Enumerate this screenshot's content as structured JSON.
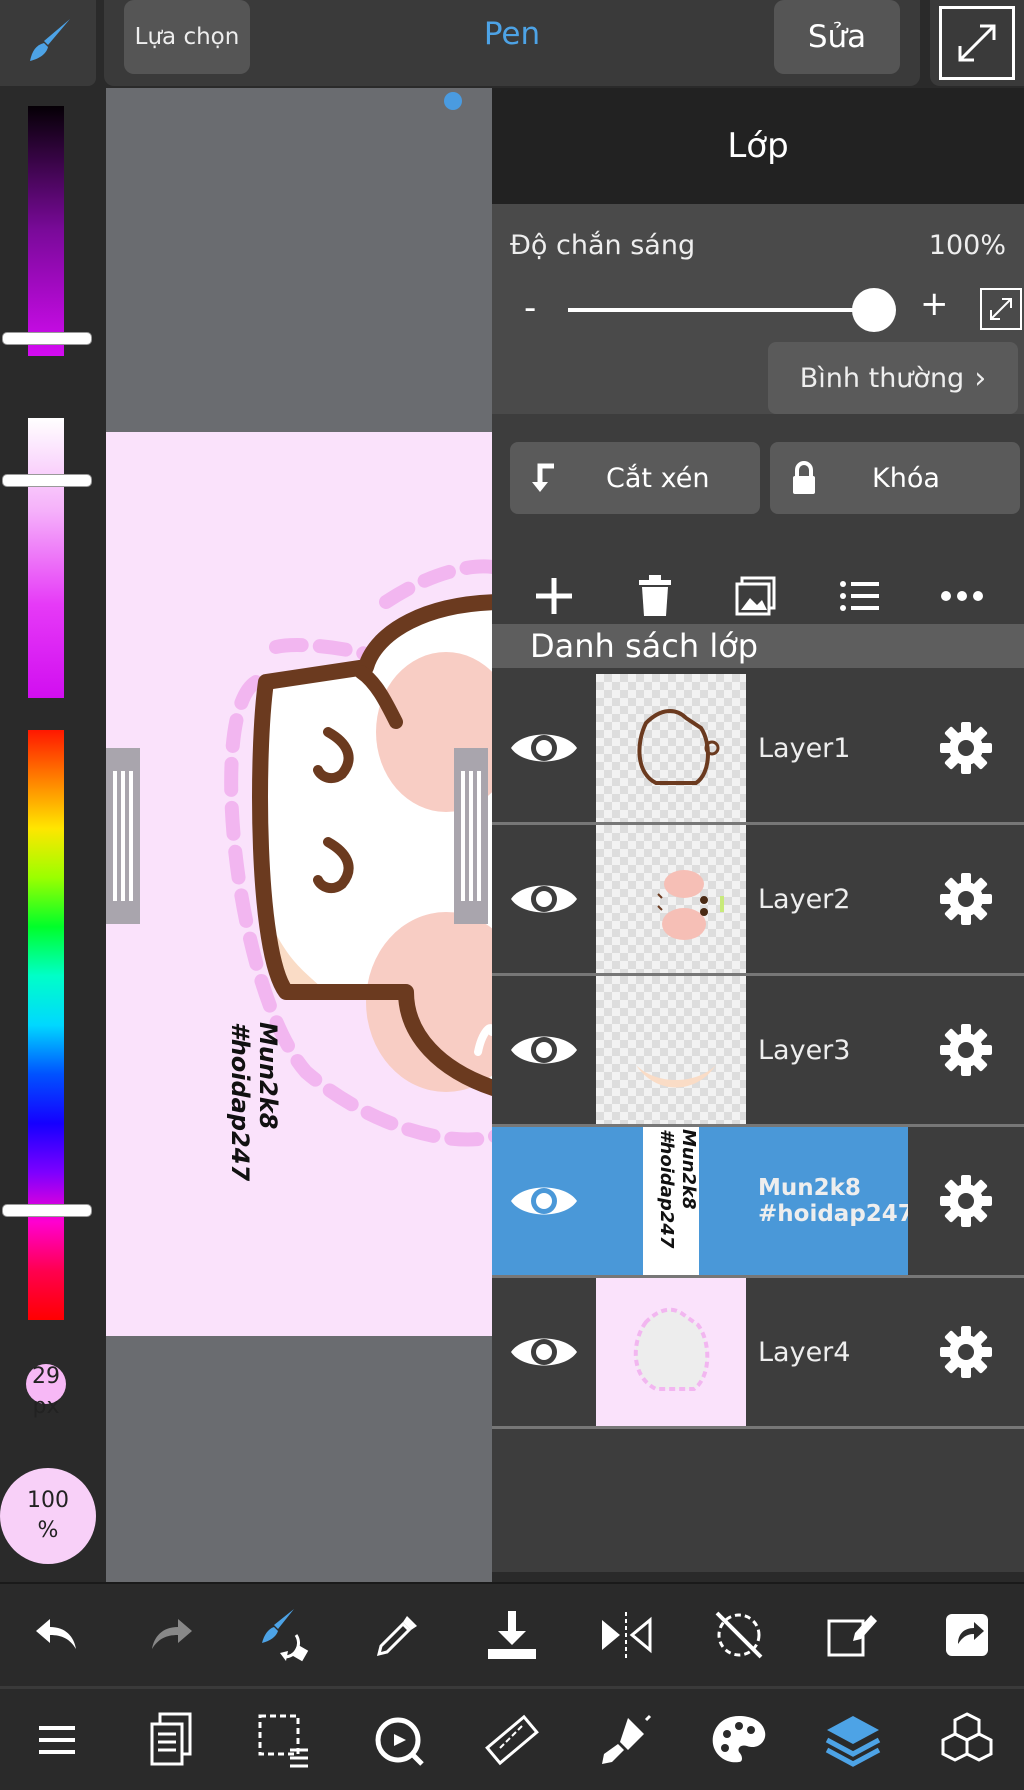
{
  "topbar": {
    "select_label": "Lựa chọn",
    "tool_label": "Pen",
    "edit_label": "Sửa"
  },
  "sidebar": {
    "brush_size": "29",
    "brush_size_unit": "px",
    "opacity_value": "100",
    "opacity_unit": "%"
  },
  "canvas": {
    "watermark_line1": "Mun2k8",
    "watermark_line2": "#hoidap247"
  },
  "layer_panel": {
    "title": "Lớp",
    "opacity_label": "Độ chắn sáng",
    "opacity_value": "100%",
    "opacity_level": 1.0,
    "minus": "-",
    "plus": "+",
    "blend_mode": "Bình thường",
    "clip_label": "Cắt xén",
    "lock_label": "Khóa",
    "list_header": "Danh sách lớp",
    "layers": [
      {
        "name": "Layer1",
        "active": false
      },
      {
        "name": "Layer2",
        "active": false
      },
      {
        "name": "Layer3",
        "active": false
      },
      {
        "name_line1": "Mun2k8",
        "name_line2": "#hoidap247",
        "active": true
      },
      {
        "name": "Layer4",
        "active": false
      }
    ]
  },
  "colors": {
    "accent": "#4a98d8",
    "canvas_bg": "#fae2fb",
    "outline_brown": "#6b3a1f"
  }
}
